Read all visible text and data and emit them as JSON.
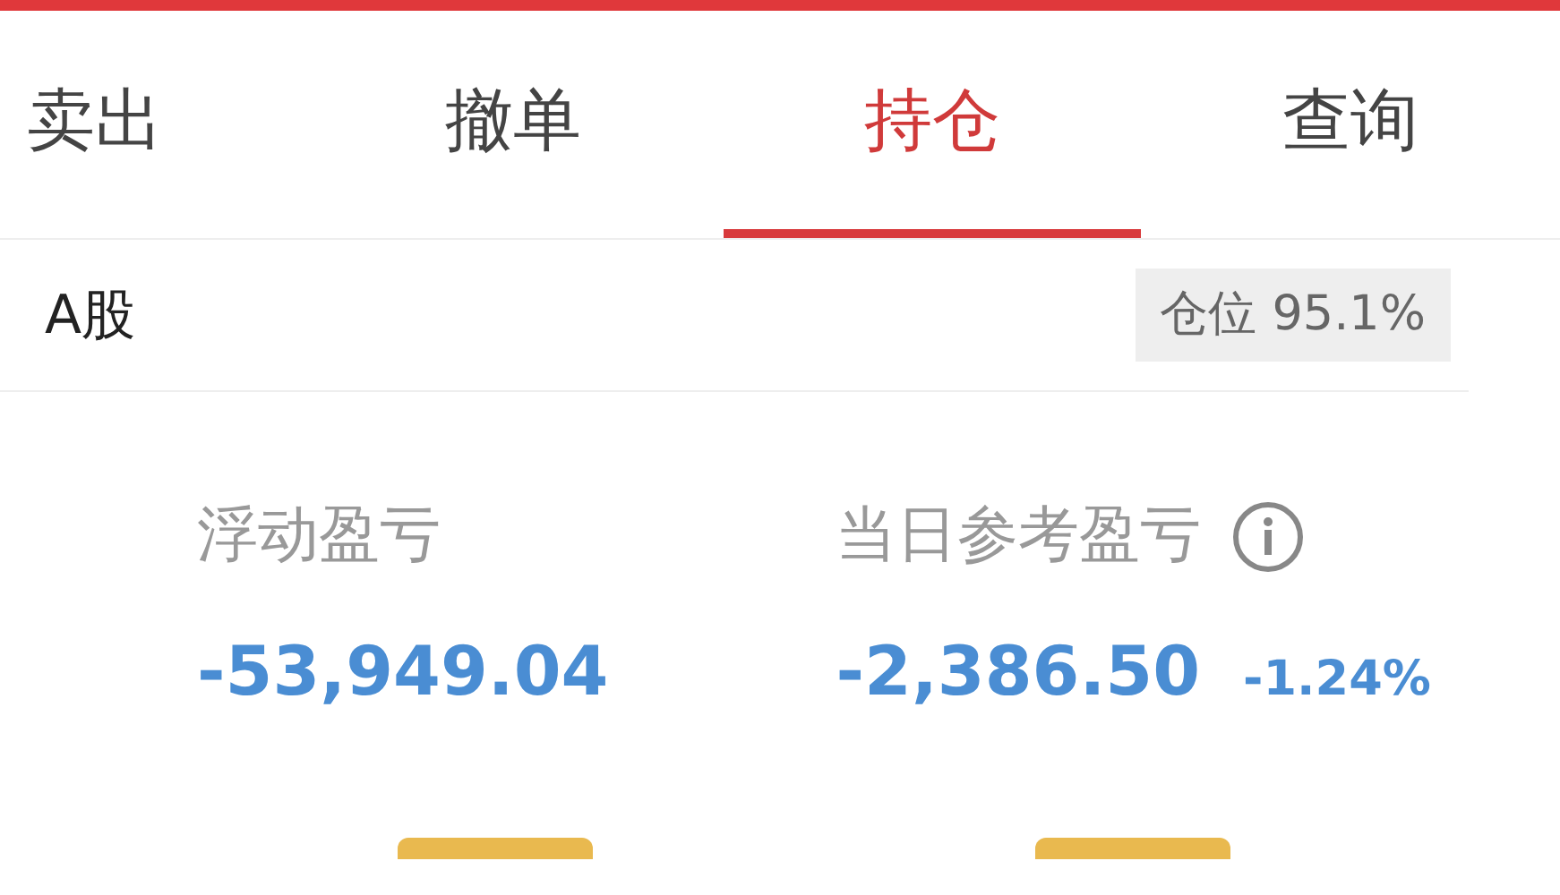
{
  "tabs": [
    {
      "label": "卖出",
      "selected": false
    },
    {
      "label": "撤单",
      "selected": false
    },
    {
      "label": "持仓",
      "selected": true
    },
    {
      "label": "查询",
      "selected": false
    }
  ],
  "account": {
    "market": "A股",
    "position_badge": "仓位 95.1%"
  },
  "stats": [
    {
      "label": "浮动盈亏",
      "value": "-53,949.04",
      "info": false
    },
    {
      "label": "当日参考盈亏",
      "value": "-2,386.50",
      "percent": "-1.24%",
      "info": true
    }
  ]
}
